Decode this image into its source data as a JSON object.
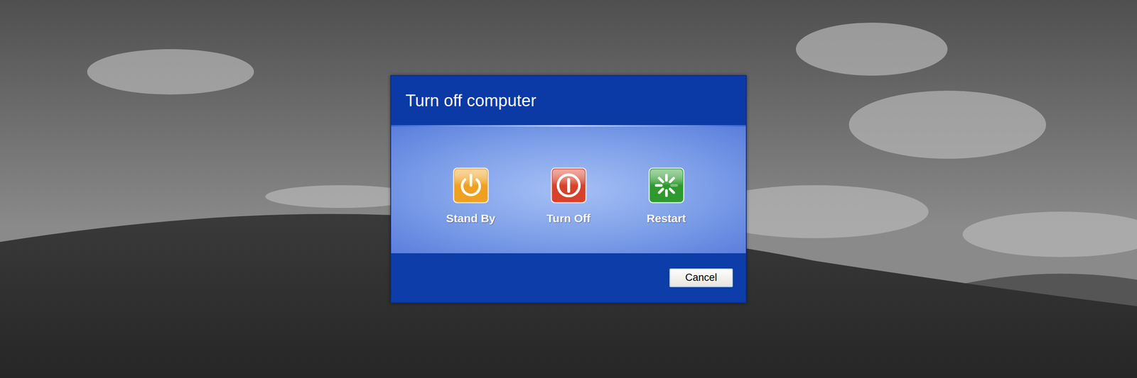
{
  "window": {
    "title": "Turn off computer"
  },
  "options": [
    {
      "label": "Stand By",
      "kind": "standby",
      "color": "#f0a020"
    },
    {
      "label": "Turn Off",
      "kind": "off",
      "color": "#d8412a"
    },
    {
      "label": "Restart",
      "kind": "restart",
      "color": "#2e9a2e"
    }
  ],
  "buttons": [
    {
      "label": "Cancel",
      "focused": true
    }
  ]
}
